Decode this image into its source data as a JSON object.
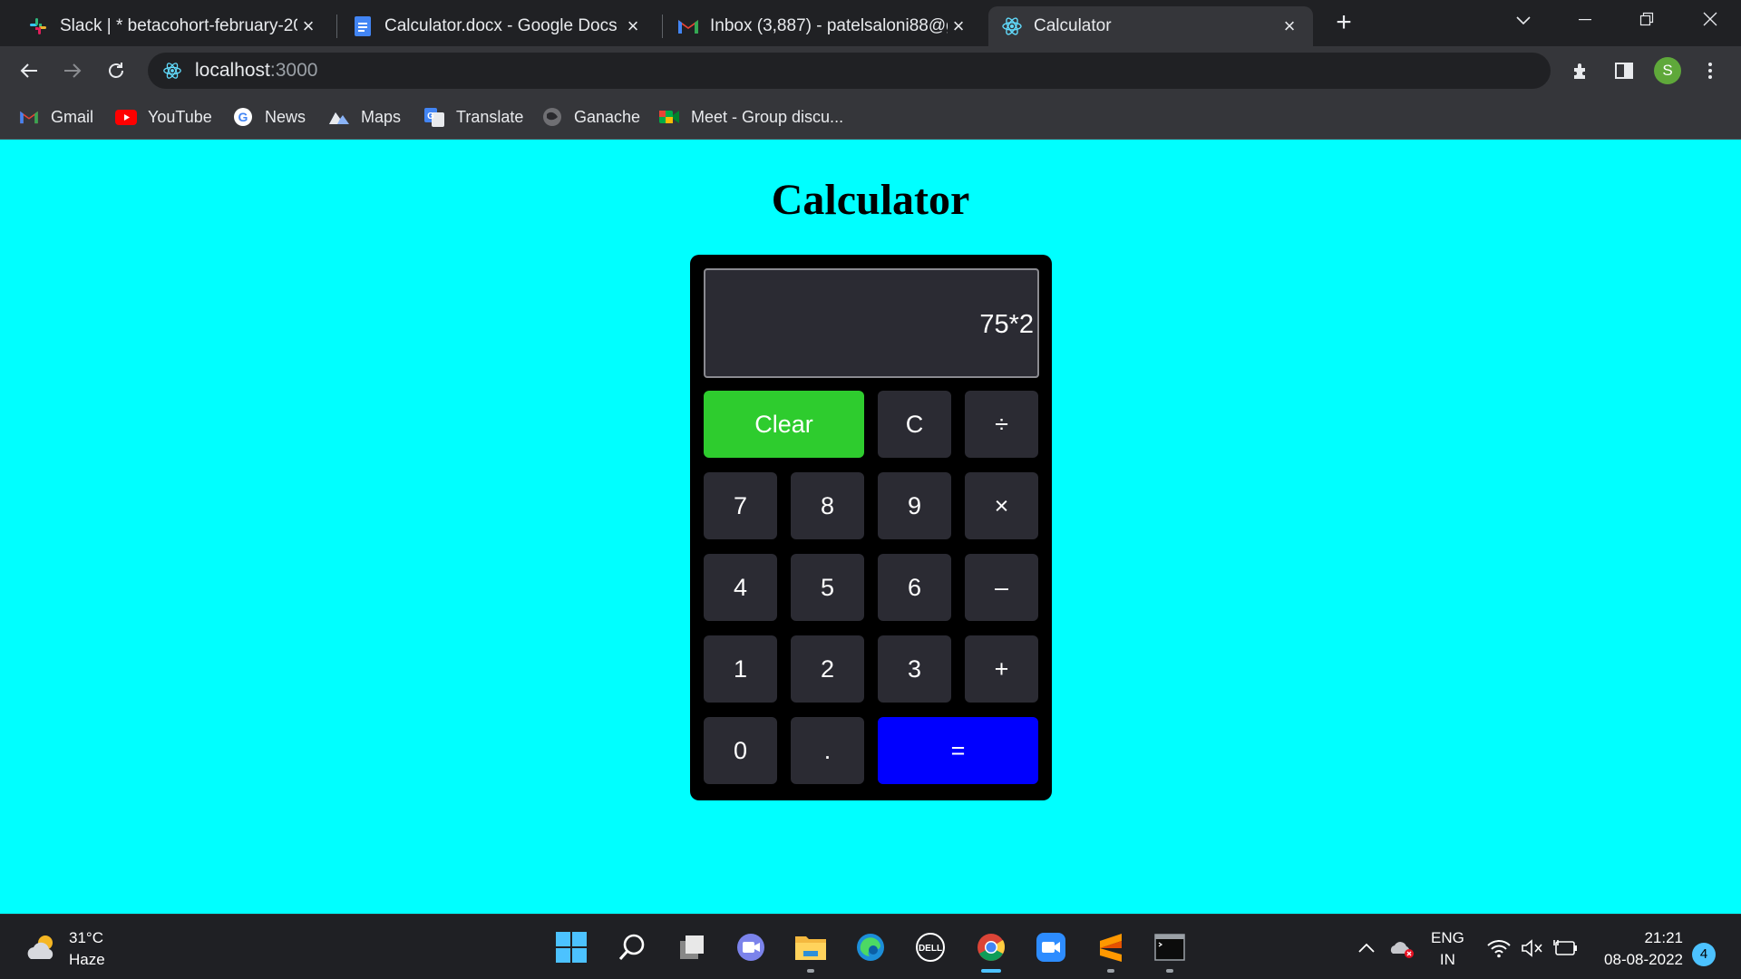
{
  "browser": {
    "tabs": [
      {
        "title": "Slack | * betacohort-february-202",
        "icon": "slack-icon"
      },
      {
        "title": "Calculator.docx - Google Docs",
        "icon": "google-docs-icon"
      },
      {
        "title": "Inbox (3,887) - patelsaloni88@gm",
        "icon": "gmail-icon"
      },
      {
        "title": "Calculator",
        "icon": "react-icon",
        "active": true
      }
    ],
    "url_host": "localhost",
    "url_port": ":3000",
    "profile_initial": "S",
    "bookmarks": [
      {
        "label": "Gmail",
        "icon": "gmail-icon"
      },
      {
        "label": "YouTube",
        "icon": "youtube-icon"
      },
      {
        "label": "News",
        "icon": "google-icon"
      },
      {
        "label": "Maps",
        "icon": "maps-icon"
      },
      {
        "label": "Translate",
        "icon": "translate-icon"
      },
      {
        "label": "Ganache",
        "icon": "ganache-icon"
      },
      {
        "label": "Meet - Group discu...",
        "icon": "meet-icon"
      }
    ]
  },
  "page": {
    "title": "Calculator",
    "display": "75*2",
    "keys": {
      "clear": "Clear",
      "backspace": "C",
      "divide": "÷",
      "seven": "7",
      "eight": "8",
      "nine": "9",
      "multiply": "×",
      "four": "4",
      "five": "5",
      "six": "6",
      "minus": "–",
      "one": "1",
      "two": "2",
      "three": "3",
      "plus": "+",
      "zero": "0",
      "dot": ".",
      "equals": "="
    },
    "colors": {
      "background": "#00ffff",
      "clear": "#2ecc2e",
      "equals": "#0000ff",
      "key": "#2b2b33"
    }
  },
  "taskbar": {
    "temperature": "31°C",
    "condition": "Haze",
    "language": "ENG",
    "region": "IN",
    "time": "21:21",
    "date": "08-08-2022",
    "notifications": "4"
  }
}
